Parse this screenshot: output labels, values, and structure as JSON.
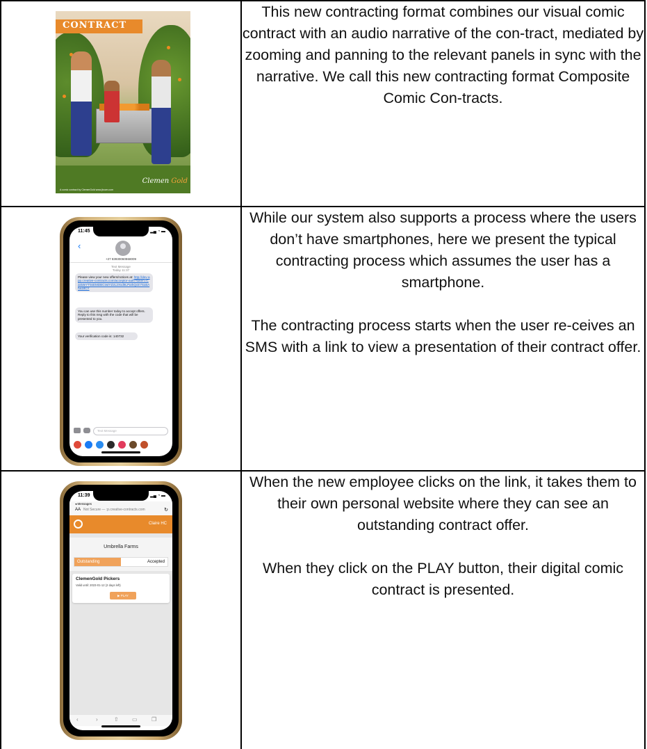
{
  "rows": [
    {
      "text": [
        "This new contracting format combines our visual comic contract with an audio narrative of the con-tract, mediated by zooming and panning to the relevant panels in sync with the narrative. We call this new contracting format Composite Comic Con-tracts."
      ],
      "cover": {
        "banner": "CONTRACT",
        "brand_left": "Clemen",
        "brand_right": "Gold",
        "footer": "A comic contract by ClemenGold www.jbcom.com",
        "accent": "#e88a2b"
      }
    },
    {
      "text": [
        "While our system also supports a process where the users don’t have smartphones, here we present the typical contracting process which assumes the user has a smartphone.",
        "The contracting process starts when the user re-ceives an SMS with a link to view a presentation of their contract offer."
      ],
      "phone": {
        "time": "11:45",
        "number": "+27 83930060868009",
        "meta_line1": "Text Message",
        "meta_line2": "Today 11:37",
        "msg1_text": "Please view your new offers/notices at: ",
        "msg1_link": "http://dev-app.creative-contracts.com/acceptor-auth?token=CasMeYT5sEMDBCIwtYZ2L2Xvd9LParkQcE7Sa5Aha18CY",
        "msg2": "You can use this number today to accept offers. Reply to this msg with the code that will be presented to you.",
        "msg3": "Your verification code is: 140732",
        "compose_placeholder": "Text Message",
        "app_colors": [
          "#e04a3a",
          "#1a7cf5",
          "#2a8cf0",
          "#2a2a2a",
          "#e23b5c",
          "#6b4a2a",
          "#c0502a"
        ]
      }
    },
    {
      "text": [
        "When the new employee clicks on the link, it takes them to their own personal website where they can see an outstanding contract offer.",
        "When they click on the PLAY button, their digital comic contract is presented."
      ],
      "web": {
        "time": "11:39",
        "back_label": "◂ Messages",
        "aa": "AA",
        "url": "Not Secure — :p.creative-contracts.com",
        "user": "Claire HC",
        "org": "Umbrella Farms",
        "tab_outstanding": "Outstanding",
        "tab_accepted": "Accepted",
        "contract_name": "ClemenGold Pickers",
        "valid_until": "Valid until: 2023-01-12 (2 days left)",
        "play_label": "▶  PLAY",
        "accent": "#e88a2b"
      }
    }
  ]
}
